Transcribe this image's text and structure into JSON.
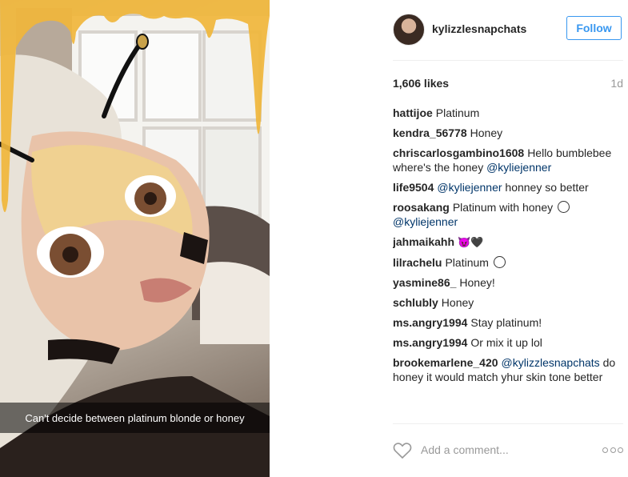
{
  "photo": {
    "caption": "Can't decide between platinum blonde or honey"
  },
  "header": {
    "username": "kylizzlesnapchats",
    "follow_label": "Follow"
  },
  "stats": {
    "likes": "1,606 likes",
    "time_ago": "1d"
  },
  "comments": [
    {
      "user": "hattijoe",
      "text": "Platinum"
    },
    {
      "user": "kendra_56778",
      "text": "Honey"
    },
    {
      "user": "chriscarlosgambino1608",
      "text": "Hello bumblebee where's the honey",
      "mention": "@kyliejenner"
    },
    {
      "user": "life9504",
      "mention": "@kyliejenner",
      "text": "honney so better"
    },
    {
      "user": "roosakang",
      "text": "Platinum with honey",
      "mention": "@kyliejenner"
    },
    {
      "user": "jahmaikahh",
      "text": "😈🖤"
    },
    {
      "user": "lilrachelu",
      "text": "Platinum"
    },
    {
      "user": "yasmine86_",
      "text": "Honey!"
    },
    {
      "user": "schlubly",
      "text": "Honey"
    },
    {
      "user": "ms.angry1994",
      "text": "Stay platinum!"
    },
    {
      "user": "ms.angry1994",
      "text": "Or mix it up lol"
    },
    {
      "user": "brookemarlene_420",
      "mention": "@kylizzlesnapchats",
      "text": "do honey it would match yhur skin tone better"
    }
  ],
  "footer": {
    "comment_placeholder": "Add a comment..."
  },
  "colors": {
    "accent": "#3897f0",
    "mention": "#003569",
    "muted": "#999999"
  },
  "icons": {
    "like": "heart-outline-icon",
    "options": "more-options-icon"
  }
}
